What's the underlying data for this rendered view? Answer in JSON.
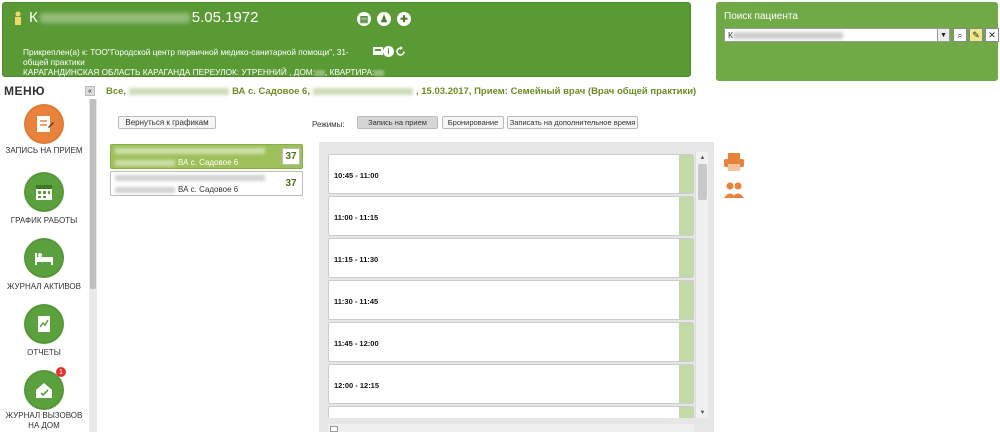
{
  "patient": {
    "name_visible_start": "К",
    "dob_suffix": "5.05.1972",
    "attachment": "Прикреплен(а) к: ТОО\"Городской центр первичной медико-санитарной помощи\", 31- общей практики",
    "address_prefix": "КАРАГАНДИНСКАЯ ОБЛАСТЬ КАРАГАНДА ПЕРЕУЛОК: УТРЕННИЙ , ДОМ:",
    "address_apt": ", КВАРТИРА:"
  },
  "search": {
    "title": "Поиск пациента",
    "value_start": "К",
    "dropdown_icon": "chevron-down-icon",
    "buttons": [
      "search-icon",
      "edit-icon",
      "close-icon"
    ]
  },
  "menu": {
    "title": "МЕНЮ",
    "collapse": "«",
    "items": [
      {
        "label": "ЗАПИСЬ НА ПРИЕМ",
        "icon": "edit-note-icon",
        "color": "#e9823a"
      },
      {
        "label": "ГРАФИК РАБОТЫ",
        "icon": "calendar-icon",
        "color": "#5aa03c"
      },
      {
        "label": "ЖУРНАЛ АКТИВОВ",
        "icon": "bed-icon",
        "color": "#5aa03c"
      },
      {
        "label": "ОТЧЕТЫ",
        "icon": "report-icon",
        "color": "#5aa03c"
      },
      {
        "label": "ЖУРНАЛ ВЫЗОВОВ НА ДОМ",
        "icon": "home-call-icon",
        "color": "#5aa03c",
        "badge": "1"
      }
    ]
  },
  "breadcrumb": {
    "start": "Все,",
    "part1": "ВА с. Садовое 6,",
    "part2": ", 15.03.2017, Прием: Семейный врач (Врач общей практики)"
  },
  "back_button": "Вернуться к графикам",
  "doctors": [
    {
      "place": "ВА с. Садовое 6",
      "count": "37"
    },
    {
      "place": "ВА с. Садовое 6",
      "count": "37"
    }
  ],
  "modes": {
    "label": "Режимы:",
    "options": [
      "Запись на прием",
      "Бронирование",
      "Записать на дополнительное время"
    ]
  },
  "slots": [
    "10:45 - 11:00",
    "11:00 - 11:15",
    "11:15 - 11:30",
    "11:30 - 11:45",
    "11:45 - 12:00",
    "12:00 - 12:15"
  ],
  "colors": {
    "header_green": "#5a9a35",
    "search_green": "#6faa46",
    "active_card": "#9ec05a",
    "accent_orange": "#e9823a",
    "slot_bar": "#c2dba6"
  }
}
